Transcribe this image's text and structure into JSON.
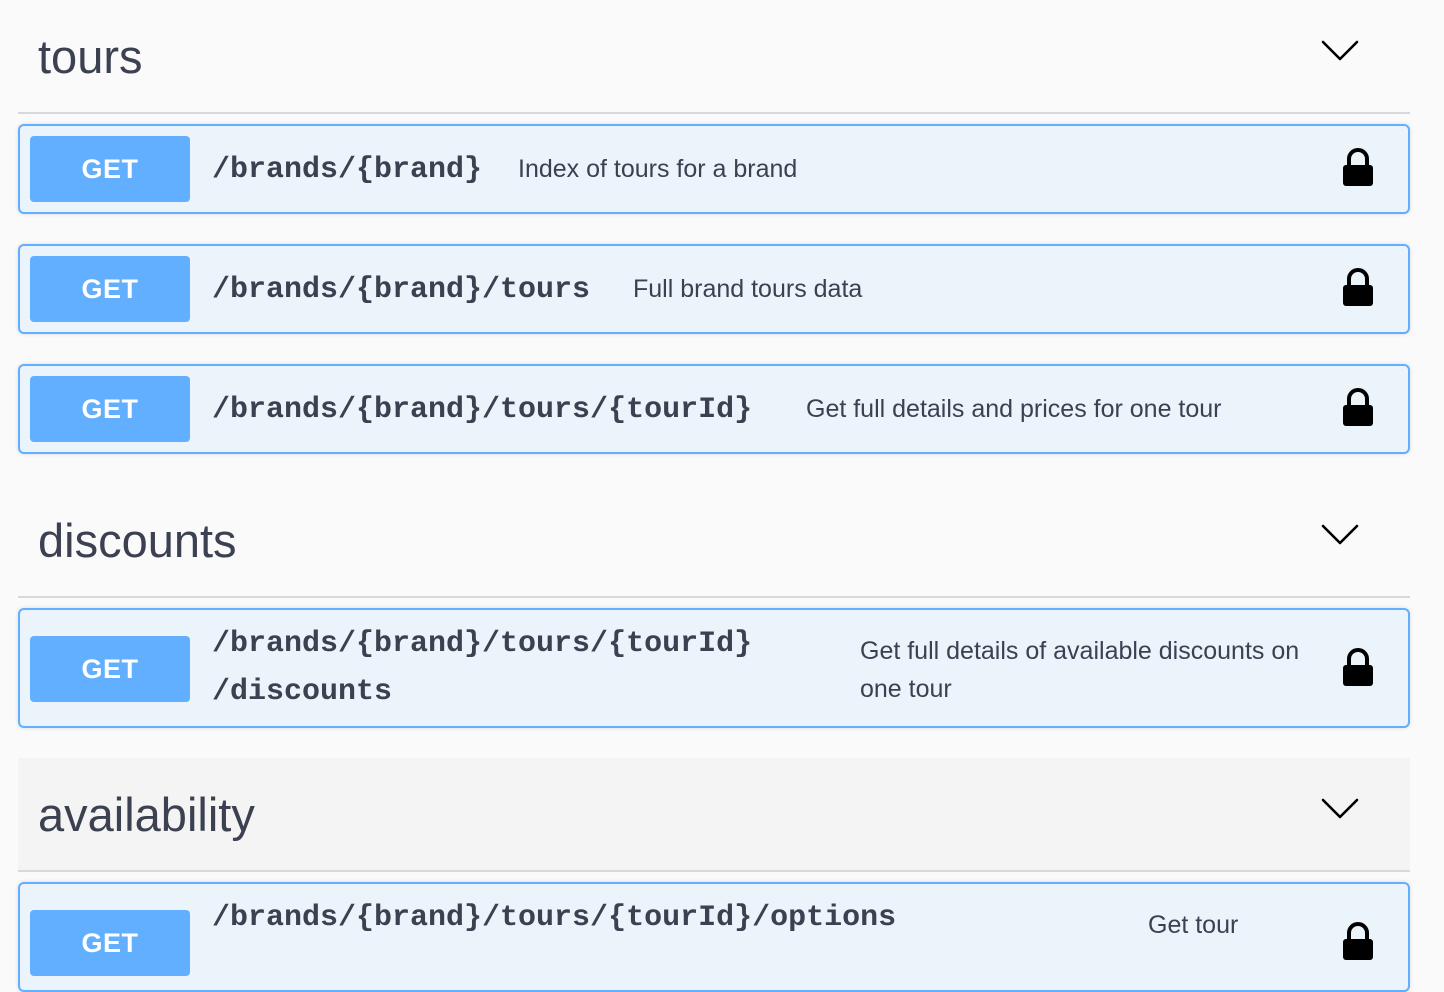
{
  "sections": [
    {
      "title": "tours",
      "icon": "chevron-down-icon",
      "operations": [
        {
          "method": "GET",
          "path": "/brands/{brand}",
          "summary": "Index of tours for a brand",
          "icon": "lock-icon"
        },
        {
          "method": "GET",
          "path": "/brands/{brand}/tours",
          "summary": "Full brand tours data",
          "icon": "lock-icon"
        },
        {
          "method": "GET",
          "path": "/brands/{brand}/tours/{tourId}",
          "summary": "Get full details and prices for one tour",
          "icon": "lock-icon"
        }
      ]
    },
    {
      "title": "discounts",
      "icon": "chevron-down-icon",
      "operations": [
        {
          "method": "GET",
          "path_line1": "/brands/{brand}/tours/{tourId}",
          "path_line2": "/discounts",
          "summary_line1": "Get full details of available discounts on",
          "summary_line2": "one tour",
          "icon": "lock-icon"
        }
      ]
    },
    {
      "title": "availability",
      "icon": "chevron-down-icon",
      "operations": [
        {
          "method": "GET",
          "path": "/brands/{brand}/tours/{tourId}/options",
          "summary": "Get tour",
          "icon": "lock-icon"
        }
      ]
    }
  ],
  "colors": {
    "get_method": "#61affe",
    "operation_bg": "#ebf3fb",
    "text": "#3b4151"
  }
}
